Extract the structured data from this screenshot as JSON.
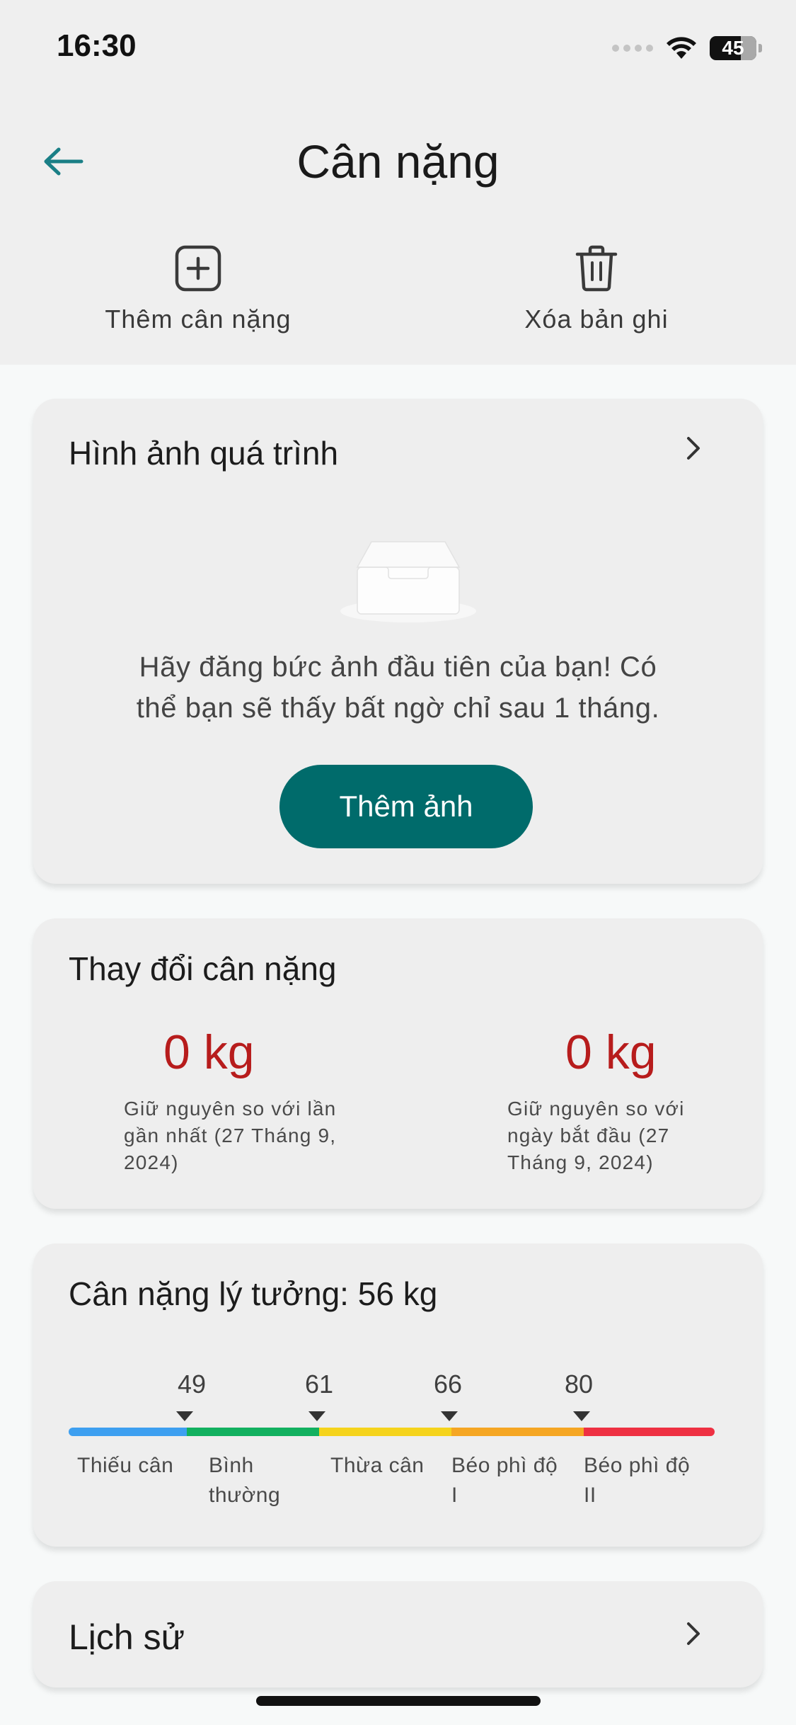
{
  "status_bar": {
    "time": "16:30",
    "battery_level": "45",
    "icons": [
      "cellular-dots-icon",
      "wifi-icon",
      "battery-icon"
    ]
  },
  "header": {
    "title": "Cân nặng",
    "back_icon": "arrow-left-icon"
  },
  "toolbar": {
    "add_label": "Thêm cân nặng",
    "add_icon": "plus-square-icon",
    "delete_label": "Xóa bản ghi",
    "delete_icon": "trash-icon"
  },
  "photos_card": {
    "title": "Hình ảnh quá trình",
    "empty_line1": "Hãy đăng bức ảnh đầu tiên của bạn! Có",
    "empty_line2": "thể bạn sẽ thấy bất ngờ chỉ sau 1 tháng.",
    "button_label": "Thêm ảnh"
  },
  "change_card": {
    "title": "Thay đổi cân nặng",
    "last": {
      "value": "0 kg",
      "desc_line1": "Giữ nguyên so với lần",
      "desc_line2": "gần nhất (27 Tháng 9,",
      "desc_line3": "2024)"
    },
    "start": {
      "value": "0 kg",
      "desc_line1": "Giữ nguyên so với",
      "desc_line2": "ngày bắt đầu (27",
      "desc_line3": "Tháng 9, 2024)"
    }
  },
  "ideal_card": {
    "title": "Cân nặng lý tưởng: 56 kg",
    "thresholds": [
      "49",
      "61",
      "66",
      "80"
    ],
    "categories": [
      {
        "line1": "Thiếu cân",
        "line2": "",
        "color": "#3d9ff0"
      },
      {
        "line1": "Bình",
        "line2": "thường",
        "color": "#12b05f"
      },
      {
        "line1": "Thừa cân",
        "line2": "",
        "color": "#f5d31c"
      },
      {
        "line1": "Béo phì độ",
        "line2": "I",
        "color": "#f5a623"
      },
      {
        "line1": "Béo phì độ",
        "line2": "II",
        "color": "#ee3042"
      }
    ]
  },
  "history_card": {
    "title": "Lịch sử"
  },
  "colors": {
    "accent": "#006b6b",
    "change_value": "#b71c1c"
  }
}
